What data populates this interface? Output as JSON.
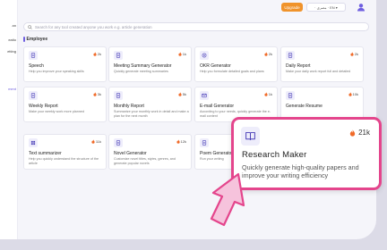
{
  "sidebar": {
    "items": [
      {
        "label": "an"
      },
      {
        "label": "eatio"
      },
      {
        "label": "etting"
      },
      {
        "label": "ment"
      }
    ]
  },
  "topbar": {
    "upgrade_label": "Upgrade",
    "language_label": "· مصری · EN ▾"
  },
  "search": {
    "placeholder": "Search for any tool created anyone you work e.g. article generation"
  },
  "section": {
    "title": "Employee"
  },
  "colors": {
    "accent": "#6f5fe0",
    "highlight": "#e4458c",
    "upgrade": "#f0932b"
  },
  "cards": [
    {
      "title": "Speech",
      "desc": "Help you improve your speaking skills",
      "count": "2k",
      "icon": "doc-icon"
    },
    {
      "title": "Meeting Summary Generator",
      "desc": "Quickly generate meeting summaries",
      "count": "1k",
      "icon": "doc-icon"
    },
    {
      "title": "OKR Generator",
      "desc": "Help you formulate detailed goals and plans",
      "count": "2k",
      "icon": "target-icon"
    },
    {
      "title": "Daily Report",
      "desc": "Make your daily work report full and detailed",
      "count": "2k",
      "icon": "doc-icon"
    },
    {
      "title": "Weekly Report",
      "desc": "Make your weekly work more planned",
      "count": "3k",
      "icon": "doc-icon"
    },
    {
      "title": "Monthly Report",
      "desc": "Summarize your monthly work in detail and make a plan for the next month",
      "count": "5k",
      "icon": "doc-icon"
    },
    {
      "title": "E-mail Generator",
      "desc": "According to your needs, quickly generate the e-mail content",
      "count": "1k",
      "icon": "mail-icon"
    },
    {
      "title": "Generate Resume",
      "desc": "",
      "count": "10k",
      "icon": "doc-icon"
    },
    {
      "title": "Text summarizer",
      "desc": "Help you quickly understand the structure of the article",
      "count": "11k",
      "icon": "grid-icon"
    },
    {
      "title": "Novel Generator",
      "desc": "Customize novel titles, styles, genres, and generate popular novels",
      "count": "12k",
      "icon": "doc-icon"
    },
    {
      "title": "Poem Generator",
      "desc": "Run your writing",
      "count": "",
      "icon": "doc-icon"
    }
  ],
  "popup": {
    "title": "Research Maker",
    "desc": "Quickly generate high-quality papers and improve your writing efficiency",
    "count": "21k",
    "icon": "book-icon"
  }
}
